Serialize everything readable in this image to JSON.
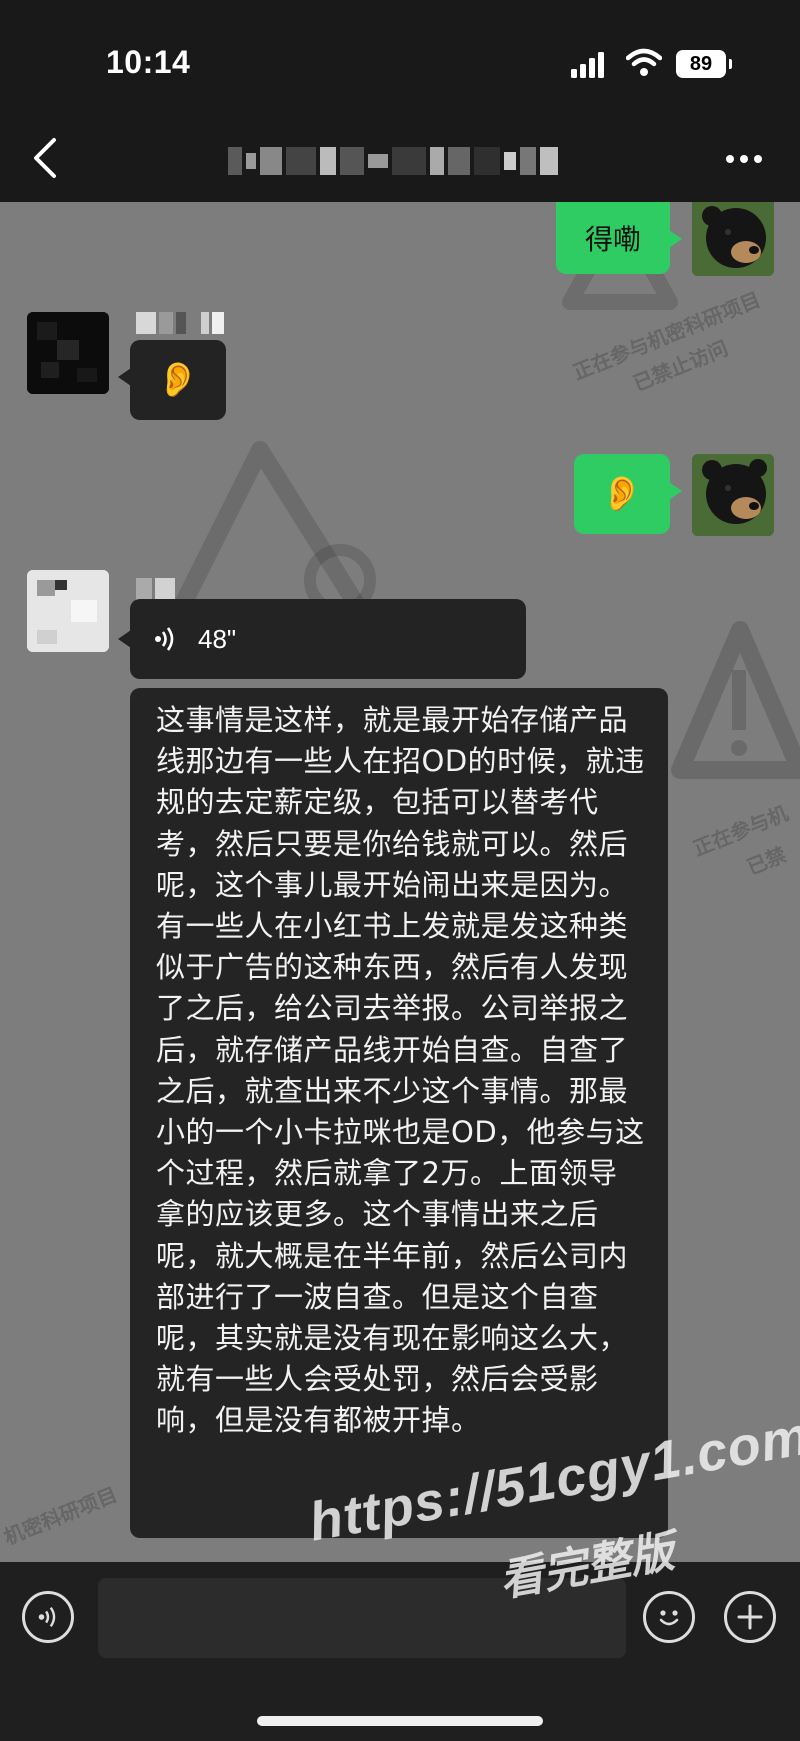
{
  "status_bar": {
    "time": "10:14",
    "battery": "89"
  },
  "header": {
    "back_icon": "chevron-left-icon",
    "more_icon": "more-dots-icon"
  },
  "watermarks": {
    "confidential_line1": "正在参与机密科研项目",
    "confidential_line2": "已禁止访问",
    "confidential_partial1": "正在参与机",
    "confidential_partial2": "已禁",
    "confidential_partial3": "机密科研项目",
    "site_url": "https://51cgy1.com",
    "site_sub": "看完整版"
  },
  "messages": [
    {
      "side": "out",
      "type": "text",
      "text": "得嘞"
    },
    {
      "side": "in",
      "type": "emoji",
      "text": "👂"
    },
    {
      "side": "out",
      "type": "emoji",
      "text": "👂"
    },
    {
      "side": "in",
      "type": "voice",
      "duration": "48\""
    },
    {
      "side": "in",
      "type": "transcript",
      "text": "这事情是这样，就是最开始存储产品线那边有一些人在招OD的时候，就违规的去定薪定级，包括可以替考代考，然后只要是你给钱就可以。然后呢，这个事儿最开始闹出来是因为。有一些人在小红书上发就是发这种类似于广告的这种东西，然后有人发现了之后，给公司去举报。公司举报之后，就存储产品线开始自查。自查了之后，就查出来不少这个事情。那最小的一个小卡拉咪也是OD，他参与这个过程，然后就拿了2万。上面领导拿的应该更多。这个事情出来之后呢，就大概是在半年前，然后公司内部进行了一波自查。但是这个自查呢，其实就是没有现在影响这么大，就有一些人会受处罚，然后会受影响，但是没有都被开掉。"
    }
  ],
  "input_bar": {
    "voice_icon": "voice-input-icon",
    "emoji_icon": "emoji-icon",
    "plus_icon": "plus-icon"
  }
}
